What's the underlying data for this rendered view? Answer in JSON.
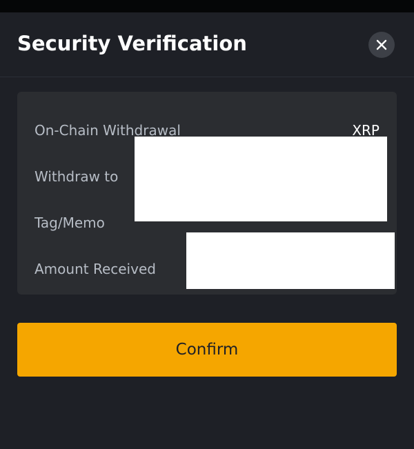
{
  "dialog": {
    "title": "Security Verification",
    "close_icon": "close-icon"
  },
  "details": {
    "rows": [
      {
        "label": "On-Chain Withdrawal",
        "value": "XRP"
      },
      {
        "label": "Withdraw to",
        "value": ""
      },
      {
        "label": "Tag/Memo",
        "value": ""
      },
      {
        "label": "Amount Received",
        "value": ""
      }
    ]
  },
  "actions": {
    "confirm_label": "Confirm"
  },
  "colors": {
    "background": "#1e2026",
    "card": "#2b2d31",
    "accent": "#f5a600",
    "label_text": "#b7bdc6",
    "value_text": "#ffffff"
  }
}
